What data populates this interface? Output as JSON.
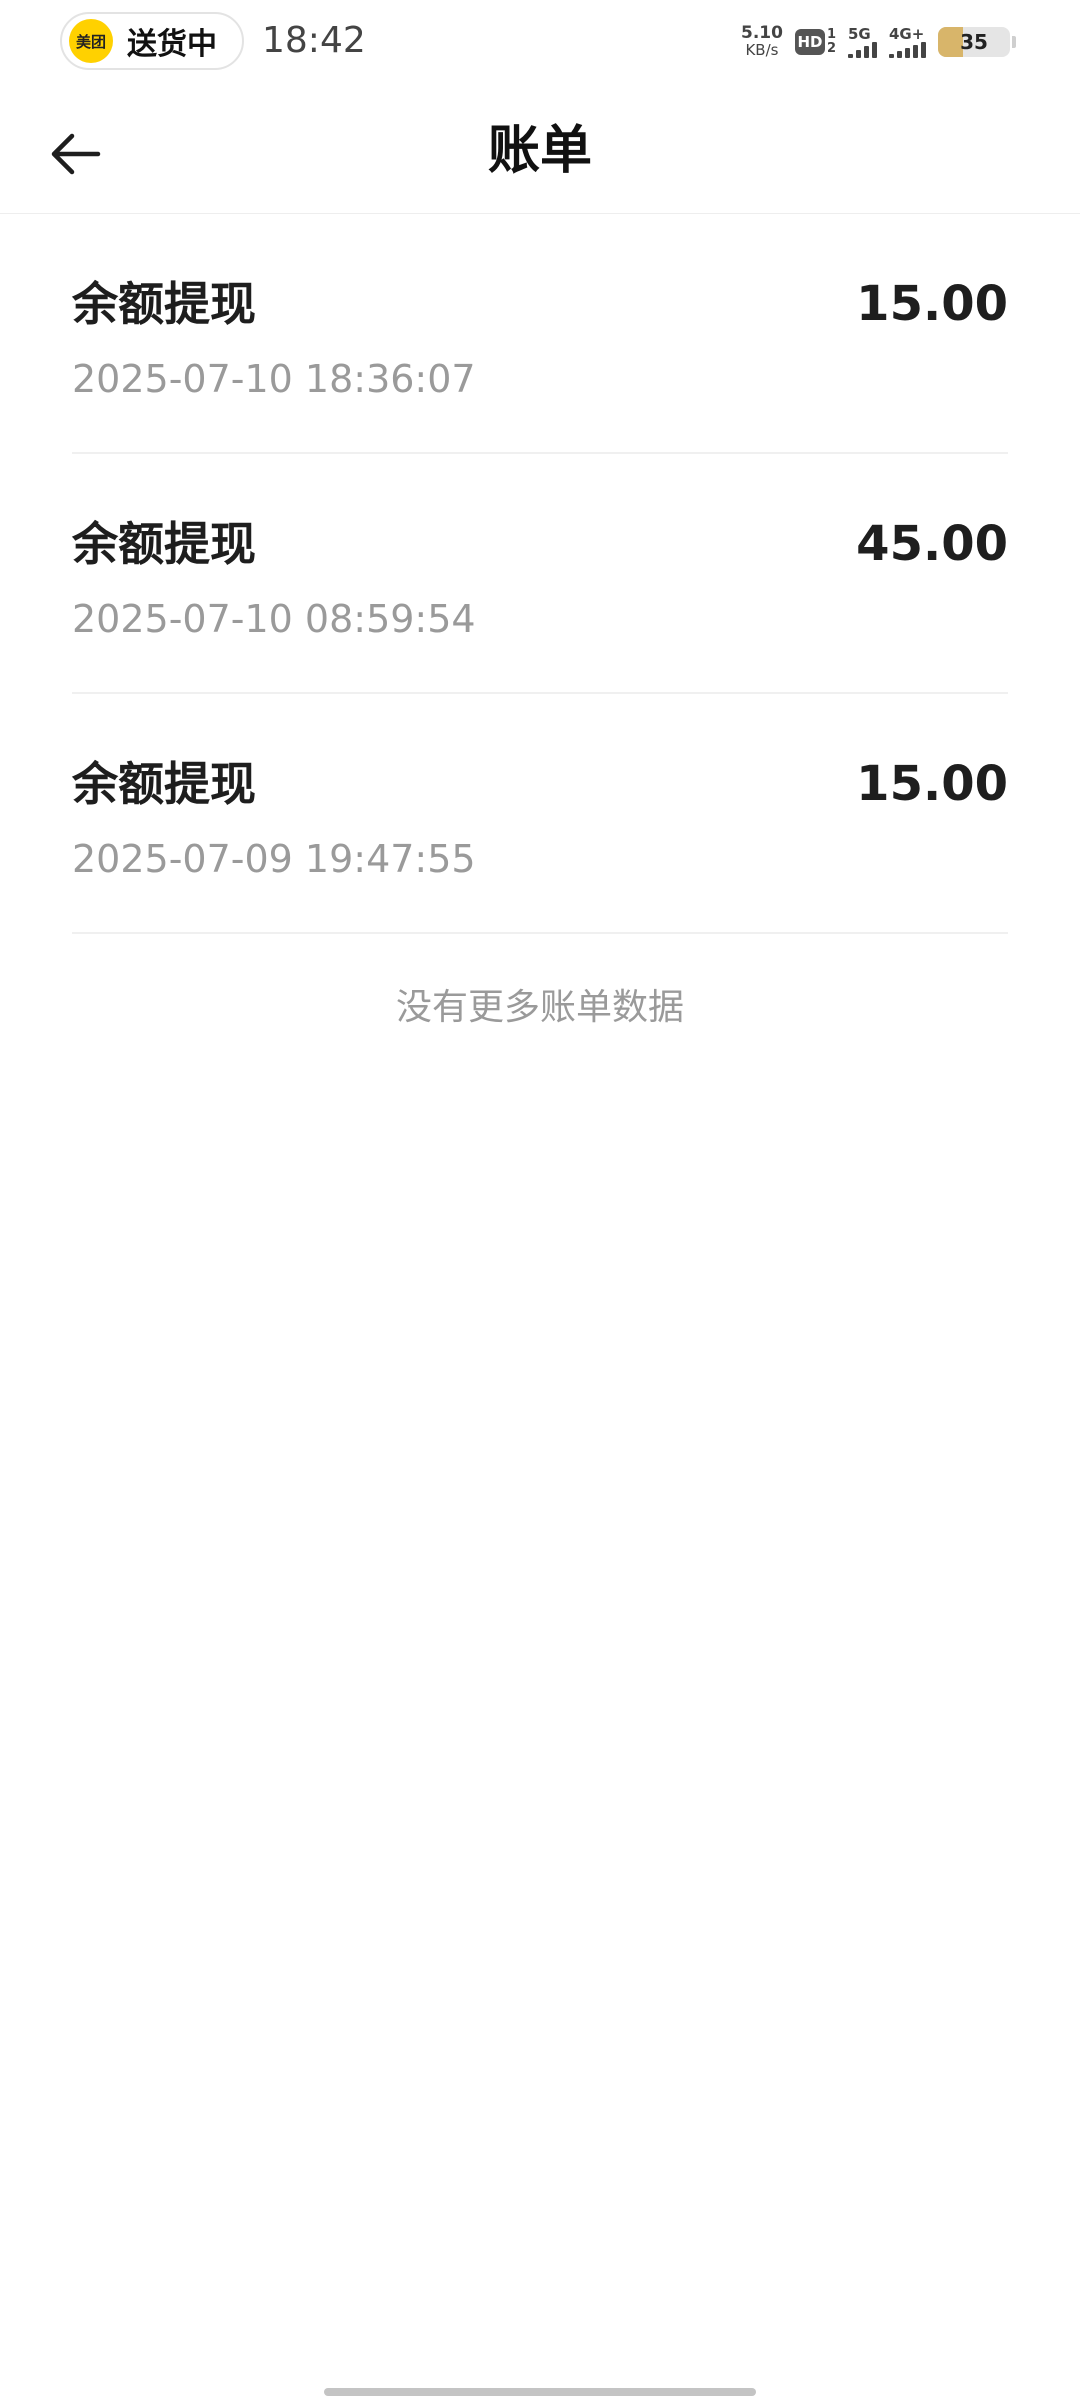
{
  "status_bar": {
    "app_badge_logo": "美团",
    "app_badge_text": "送货中",
    "time": "18:42",
    "net_speed_value": "5.10",
    "net_speed_unit": "KB/s",
    "hd_label": "HD",
    "hd_sup": "1",
    "hd_sub": "2",
    "signal1_label": "5G",
    "signal2_label": "4G+",
    "battery_level": "35"
  },
  "header": {
    "back_icon": "arrow-left-icon",
    "title": "账单"
  },
  "bills": [
    {
      "title": "余额提现",
      "time": "2025-07-10 18:36:07",
      "amount": "15.00"
    },
    {
      "title": "余额提现",
      "time": "2025-07-10 08:59:54",
      "amount": "45.00"
    },
    {
      "title": "余额提现",
      "time": "2025-07-09 19:47:55",
      "amount": "15.00"
    }
  ],
  "footer_note": "没有更多账单数据",
  "colors": {
    "accent_yellow": "#ffd100",
    "battery_fill": "#d8b56a",
    "secondary_text": "#9a9a9a"
  }
}
